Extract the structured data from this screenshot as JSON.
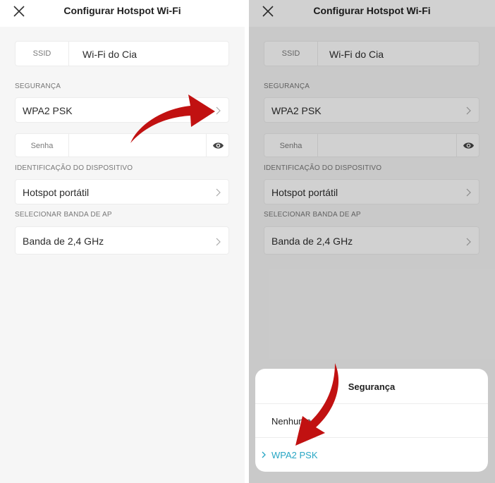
{
  "colors": {
    "accent": "#27a6c4",
    "arrow": "#c11111"
  },
  "left_screen": {
    "title": "Configurar Hotspot Wi-Fi",
    "ssid": {
      "label": "SSID",
      "value": "Wi-Fi do Cia"
    },
    "security_section": "SEGURANÇA",
    "security_value": "WPA2 PSK",
    "password": {
      "label": "Senha",
      "value": ""
    },
    "device_section": "IDENTIFICAÇÃO DO DISPOSITIVO",
    "device_value": "Hotspot portátil",
    "band_section": "SELECIONAR BANDA DE AP",
    "band_value": "Banda de 2,4 GHz"
  },
  "right_screen": {
    "title": "Configurar Hotspot Wi-Fi",
    "ssid": {
      "label": "SSID",
      "value": "Wi-Fi do Cia"
    },
    "security_section": "SEGURANÇA",
    "security_value": "WPA2 PSK",
    "password": {
      "label": "Senha",
      "value": ""
    },
    "device_section": "IDENTIFICAÇÃO DO DISPOSITIVO",
    "device_value": "Hotspot portátil",
    "band_section": "SELECIONAR BANDA DE AP",
    "band_value": "Banda de 2,4 GHz",
    "sheet": {
      "title": "Segurança",
      "options": [
        "Nenhuma",
        "WPA2 PSK"
      ],
      "selected": "WPA2 PSK"
    }
  }
}
